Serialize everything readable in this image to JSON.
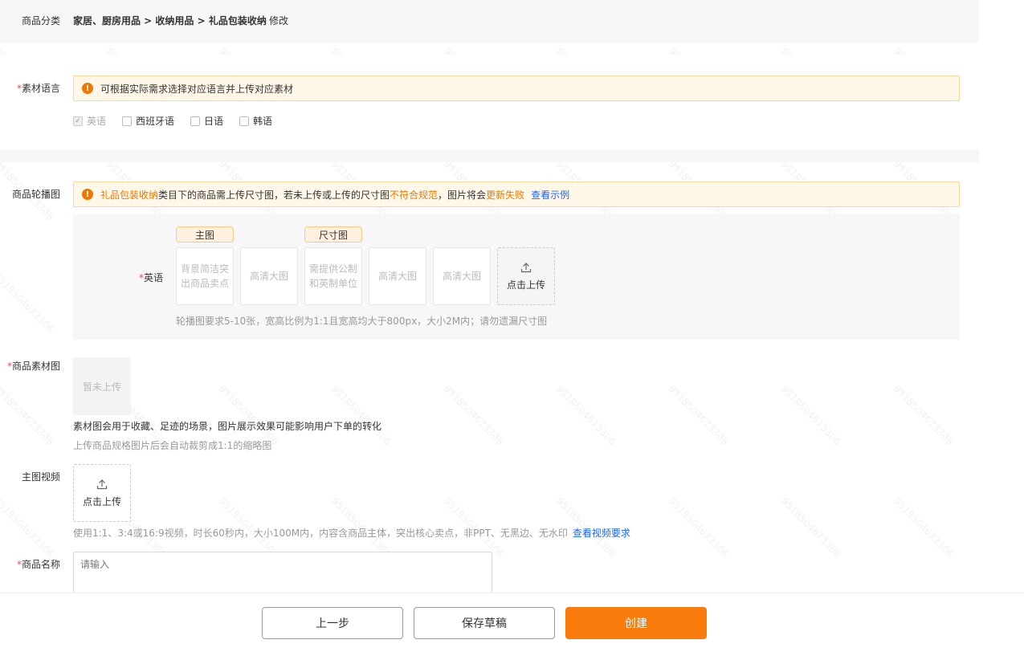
{
  "category": {
    "label": "商品分类",
    "path": "家居、厨房用品 > 收纳用品 > 礼品包装收纳",
    "edit": "修改"
  },
  "material_language": {
    "required": "*",
    "label": "素材语言",
    "notice": "可根据实际需求选择对应语言并上传对应素材",
    "options": [
      {
        "label": "英语",
        "checked": true,
        "disabled": true
      },
      {
        "label": "西班牙语",
        "checked": false,
        "disabled": false
      },
      {
        "label": "日语",
        "checked": false,
        "disabled": false
      },
      {
        "label": "韩语",
        "checked": false,
        "disabled": false
      }
    ]
  },
  "carousel": {
    "label": "商品轮播图",
    "notice": {
      "category": "礼品包装收纳",
      "text1": "类目下的商品需上传尺寸图，若未上传或上传的尺寸图",
      "warn1": "不符合规范",
      "text2": "，图片将会",
      "warn2": "更新失败",
      "link": "查看示例"
    },
    "lang_label": "英语",
    "required": "*",
    "tag_main": "主图",
    "tag_size": "尺寸图",
    "slots": [
      "背景简洁突出商品卖点",
      "高清大图",
      "需提供公制和英制单位",
      "高清大图",
      "高清大图"
    ],
    "upload_label": "点击上传",
    "hint": "轮播图要求5-10张，宽高比例为1:1且宽高均大于800px，大小2M内；请勿遗漏尺寸图"
  },
  "material_image": {
    "required": "*",
    "label": "商品素材图",
    "placeholder": "暂未上传",
    "desc": "素材图会用于收藏、足迹的场景，图片展示效果可能影响用户下单的转化",
    "hint": "上传商品规格图片后会自动裁剪成1:1的缩略图"
  },
  "video": {
    "label": "主图视频",
    "upload_label": "点击上传",
    "hint": "使用1:1、3:4或16:9视频，时长60秒内，大小100M内，内容含商品主体，突出核心卖点，非PPT、无黑边、无水印",
    "link": "查看视频要求"
  },
  "product_name": {
    "required": "*",
    "label": "商品名称",
    "placeholder": "请输入"
  },
  "footer": {
    "prev": "上一步",
    "draft": "保存草稿",
    "create": "创建"
  },
  "watermark": "9518504673306",
  "colors": {
    "accent": "#f97b0b",
    "link": "#1966ff",
    "warning": "#f07700"
  }
}
